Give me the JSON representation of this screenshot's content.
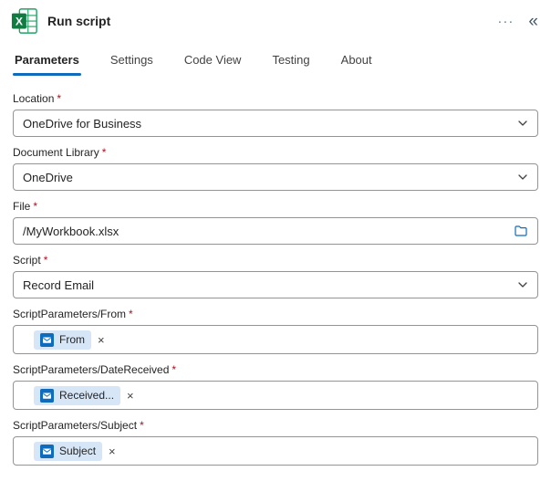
{
  "header": {
    "title": "Run script"
  },
  "icons_text": {
    "more": "···",
    "collapse": "«",
    "remove": "×"
  },
  "tabs": [
    {
      "label": "Parameters",
      "active": true
    },
    {
      "label": "Settings",
      "active": false
    },
    {
      "label": "Code View",
      "active": false
    },
    {
      "label": "Testing",
      "active": false
    },
    {
      "label": "About",
      "active": false
    }
  ],
  "fields": [
    {
      "label": "Location",
      "required": "*",
      "value": "OneDrive for Business",
      "type": "select"
    },
    {
      "label": "Document Library",
      "required": "*",
      "value": "OneDrive",
      "type": "select"
    },
    {
      "label": "File",
      "required": "*",
      "value": "/MyWorkbook.xlsx",
      "type": "file"
    },
    {
      "label": "Script",
      "required": "*",
      "value": "Record Email",
      "type": "select"
    },
    {
      "label": "ScriptParameters/From",
      "required": "*",
      "token": "From",
      "type": "token"
    },
    {
      "label": "ScriptParameters/DateReceived",
      "required": "*",
      "token": "Received...",
      "type": "token"
    },
    {
      "label": "ScriptParameters/Subject",
      "required": "*",
      "token": "Subject",
      "type": "token"
    }
  ],
  "colors": {
    "accent": "#0f6cbd",
    "required": "#b10e1c",
    "token_bg": "#d6e6f7",
    "excel_green": "#107c41",
    "border": "#949494"
  }
}
